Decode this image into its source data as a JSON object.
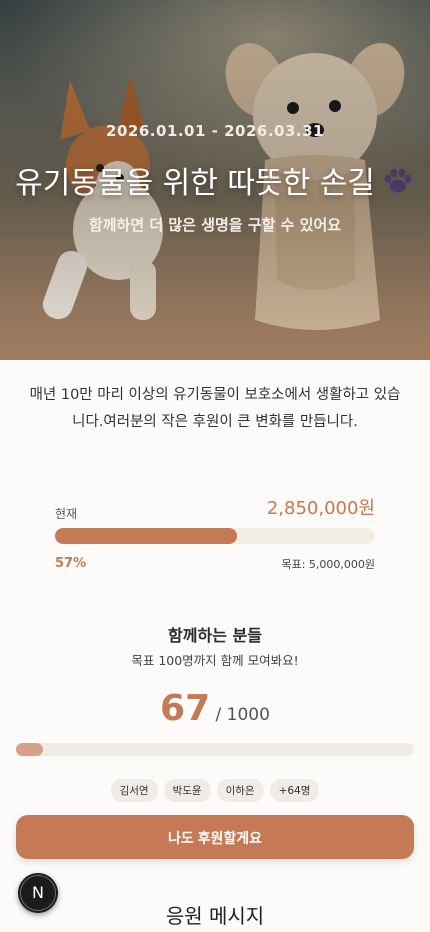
{
  "hero": {
    "date_range": "2026.01.01 - 2026.03.31",
    "title": "유기동물을 위한 따뜻한 손길",
    "title_icon": "paw-icon",
    "subtitle": "함께하면 더 많은 생명을 구할 수 있어요"
  },
  "intro": {
    "text": "매년 10만 마리 이상의 유기동물이 보호소에서 생활하고 있습니다.여러분의 작은 후원이 큰 변화를 만듭니다."
  },
  "funding": {
    "current_label": "현재",
    "current_amount": "2,850,000원",
    "percent_label": "57%",
    "progress_fraction": 0.57,
    "goal_text": "목표: 5,000,000원"
  },
  "supporters": {
    "title": "함께하는 분들",
    "subtitle": "목표 100명까지 함께 모여봐요!",
    "count": "67",
    "total_text": " / 1000",
    "progress_fraction": 0.067,
    "names": [
      "김서연",
      "박도윤",
      "이하은",
      "+64명"
    ]
  },
  "cta": {
    "label": "나도 후원할게요"
  },
  "fab": {
    "label": "N"
  },
  "messages": {
    "title": "응원 메시지"
  },
  "colors": {
    "accent": "#c57a55",
    "accent_light": "#d8a08a",
    "track": "#efece7",
    "background": "#fcfbf9"
  }
}
